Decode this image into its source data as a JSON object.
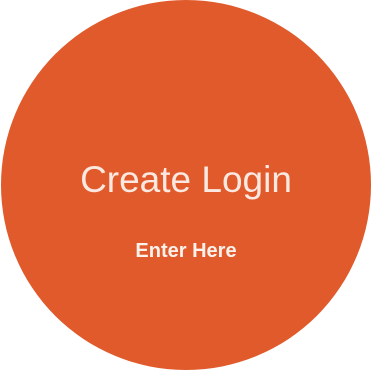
{
  "create_login": {
    "title": "Create Login",
    "subtitle": "Enter Here",
    "background_color": "#e05a2b",
    "text_color": "#fbe8e0"
  }
}
